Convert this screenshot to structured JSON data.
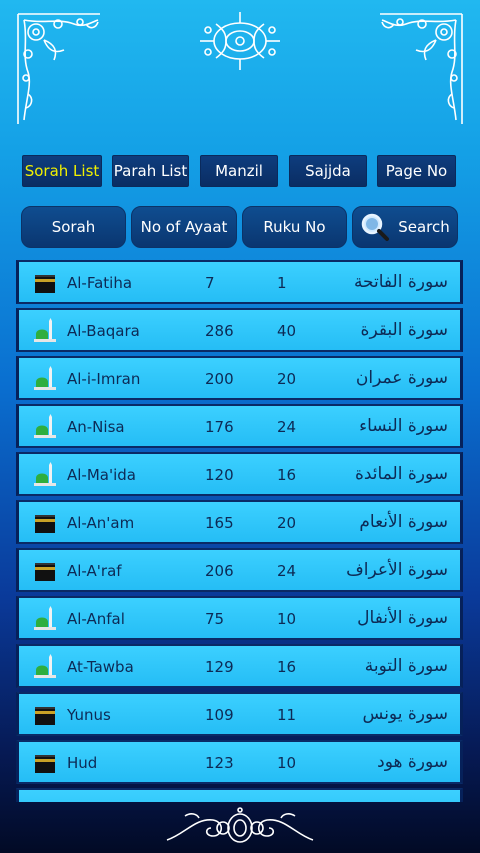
{
  "tabs": [
    {
      "label": "Sorah List",
      "active": true
    },
    {
      "label": "Parah List",
      "active": false
    },
    {
      "label": "Manzil",
      "active": false
    },
    {
      "label": "Sajjda",
      "active": false
    },
    {
      "label": "Page No",
      "active": false
    }
  ],
  "sort": {
    "sorah": "Sorah",
    "ayaat": "No of Ayaat",
    "ruku": "Ruku No",
    "search": "Search"
  },
  "surahs": [
    {
      "en": "Al-Fatiha",
      "ayat": "7",
      "ruku": "1",
      "ar": "سورة الفاتحة",
      "icon": "kaaba-icon"
    },
    {
      "en": "Al-Baqara",
      "ayat": "286",
      "ruku": "40",
      "ar": "سورة البقرة",
      "icon": "mosque-icon"
    },
    {
      "en": "Al-i-Imran",
      "ayat": "200",
      "ruku": "20",
      "ar": "سورة عمران",
      "icon": "mosque-icon"
    },
    {
      "en": "An-Nisa",
      "ayat": "176",
      "ruku": "24",
      "ar": "سورة النساء",
      "icon": "mosque-icon"
    },
    {
      "en": "Al-Ma'ida",
      "ayat": "120",
      "ruku": "16",
      "ar": "سورة المائدة",
      "icon": "mosque-icon"
    },
    {
      "en": "Al-An'am",
      "ayat": "165",
      "ruku": "20",
      "ar": "سورة الأنعام",
      "icon": "kaaba-icon"
    },
    {
      "en": "Al-A'raf",
      "ayat": "206",
      "ruku": "24",
      "ar": "سورة الأعراف",
      "icon": "kaaba-icon"
    },
    {
      "en": "Al-Anfal",
      "ayat": "75",
      "ruku": "10",
      "ar": "سورة الأنفال",
      "icon": "mosque-icon"
    },
    {
      "en": "At-Tawba",
      "ayat": "129",
      "ruku": "16",
      "ar": "سورة التوبة",
      "icon": "mosque-icon"
    },
    {
      "en": "Yunus",
      "ayat": "109",
      "ruku": "11",
      "ar": "سورة يونس",
      "icon": "kaaba-icon"
    },
    {
      "en": "Hud",
      "ayat": "123",
      "ruku": "10",
      "ar": "سورة هود",
      "icon": "kaaba-icon"
    }
  ],
  "colors": {
    "active_tab_text": "#f0f000",
    "row_bg": "#2cc4f8",
    "tab_bg": "#0d3a78"
  }
}
